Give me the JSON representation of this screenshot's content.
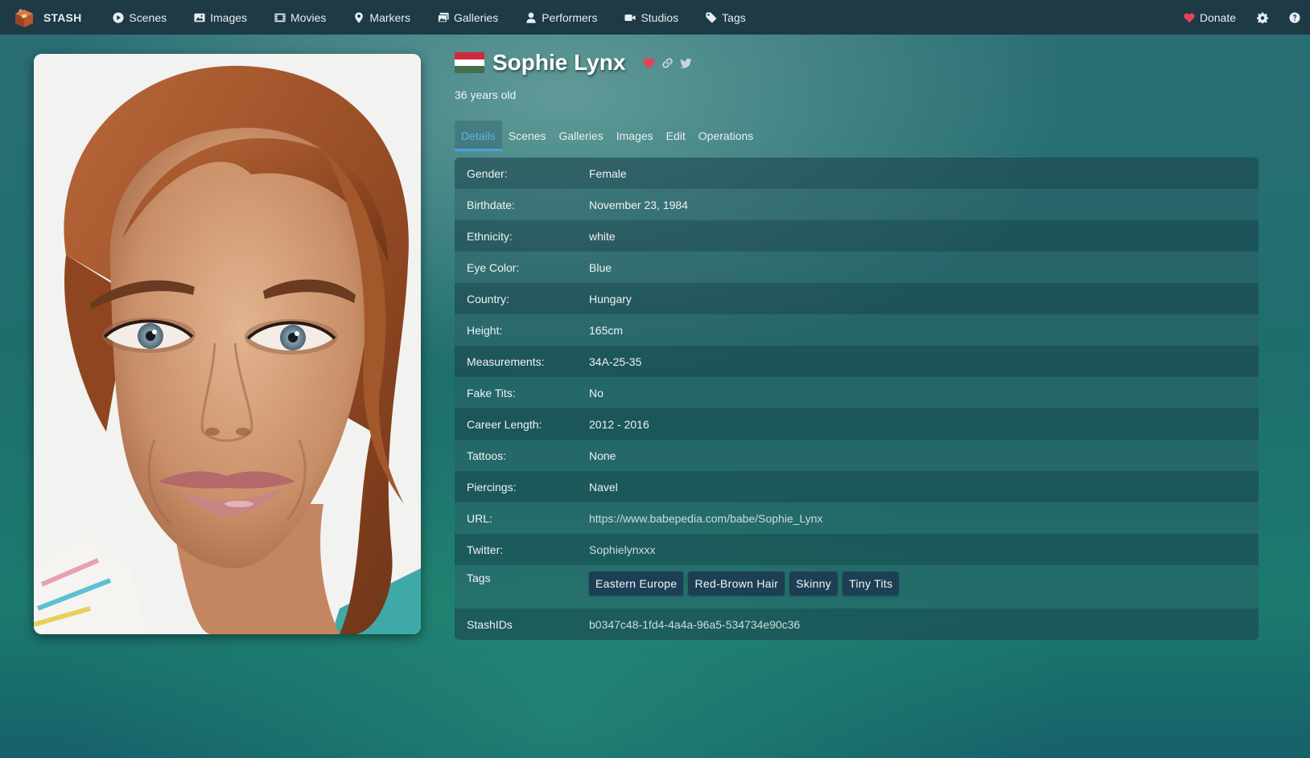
{
  "nav": {
    "brand": "STASH",
    "items": [
      {
        "label": "Scenes",
        "icon": "play-circle-icon"
      },
      {
        "label": "Images",
        "icon": "image-icon"
      },
      {
        "label": "Movies",
        "icon": "film-icon"
      },
      {
        "label": "Markers",
        "icon": "map-marker-icon"
      },
      {
        "label": "Galleries",
        "icon": "images-icon"
      },
      {
        "label": "Performers",
        "icon": "user-icon"
      },
      {
        "label": "Studios",
        "icon": "video-icon"
      },
      {
        "label": "Tags",
        "icon": "tag-icon"
      }
    ],
    "donate": "Donate"
  },
  "performer": {
    "name": "Sophie Lynx",
    "age": "36 years old",
    "flag_colors": [
      "#cd2a3e",
      "#ffffff",
      "#436f4d"
    ]
  },
  "tabs": [
    "Details",
    "Scenes",
    "Galleries",
    "Images",
    "Edit",
    "Operations"
  ],
  "details": {
    "rows": [
      {
        "label": "Gender:",
        "value": "Female"
      },
      {
        "label": "Birthdate:",
        "value": "November 23, 1984"
      },
      {
        "label": "Ethnicity:",
        "value": "white"
      },
      {
        "label": "Eye Color:",
        "value": "Blue"
      },
      {
        "label": "Country:",
        "value": "Hungary"
      },
      {
        "label": "Height:",
        "value": "165cm"
      },
      {
        "label": "Measurements:",
        "value": "34A-25-35"
      },
      {
        "label": "Fake Tits:",
        "value": "No"
      },
      {
        "label": "Career Length:",
        "value": "2012 - 2016"
      },
      {
        "label": "Tattoos:",
        "value": "None"
      },
      {
        "label": "Piercings:",
        "value": "Navel"
      },
      {
        "label": "URL:",
        "value": "https://www.babepedia.com/babe/Sophie_Lynx"
      },
      {
        "label": "Twitter:",
        "value": "Sophielynxxx"
      }
    ],
    "tags_label": "Tags",
    "tags": [
      "Eastern Europe",
      "Red-Brown Hair",
      "Skinny",
      "Tiny Tits"
    ],
    "stashids_label": "StashIDs",
    "stashid": "b0347c48-1fd4-4a4a-96a5-534734e90c36"
  },
  "colors": {
    "navbar": "#1d3a45",
    "accent": "#4aa3df",
    "tag_bg": "#1d3f55",
    "favorite": "#e8405a"
  }
}
